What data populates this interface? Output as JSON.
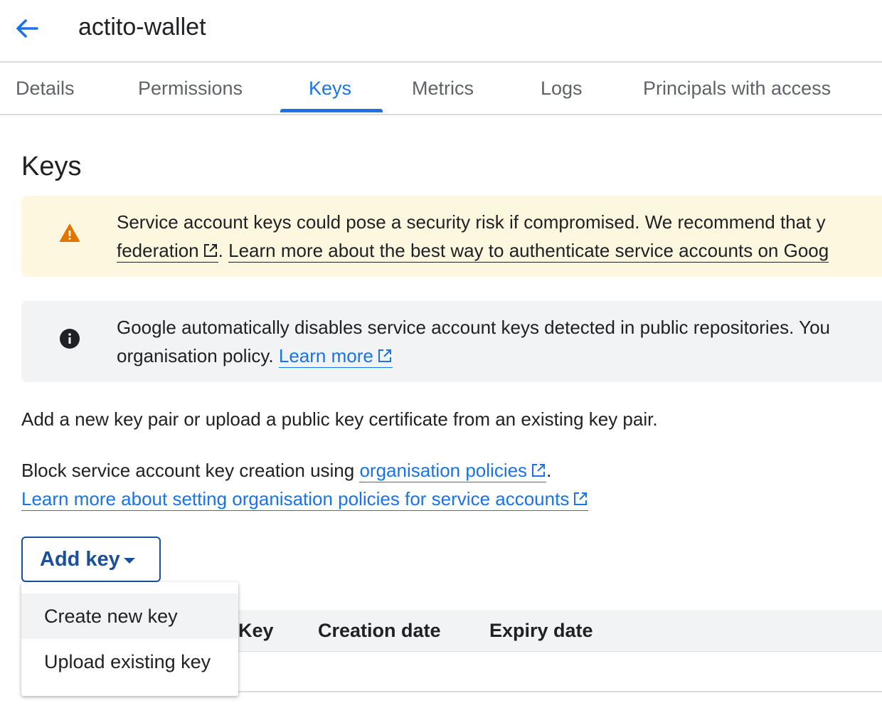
{
  "header": {
    "title": "actito-wallet"
  },
  "tabs": [
    {
      "label": "Details"
    },
    {
      "label": "Permissions"
    },
    {
      "label": "Keys"
    },
    {
      "label": "Metrics"
    },
    {
      "label": "Logs"
    },
    {
      "label": "Principals with access"
    }
  ],
  "active_tab": "Keys",
  "page": {
    "heading": "Keys"
  },
  "warning_banner": {
    "line1": "Service account keys could pose a security risk if compromised. We recommend that y",
    "link1": "federation",
    "period": ".",
    "link2": "Learn more about the best way to authenticate service accounts on Goog"
  },
  "info_banner": {
    "line1": "Google automatically disables service account keys detected in public repositories. You",
    "line2": "organisation policy.",
    "link": "Learn more"
  },
  "description": "Add a new key pair or upload a public key certificate from an existing key pair.",
  "block": {
    "text": "Block service account key creation using",
    "link": "organisation policies",
    "period": ".",
    "learn_link": "Learn more about setting organisation policies for service accounts"
  },
  "add_key_button": {
    "label": "Add key"
  },
  "dropdown": {
    "items": [
      {
        "label": "Create new key"
      },
      {
        "label": "Upload existing key"
      }
    ]
  },
  "table": {
    "columns": [
      "Key",
      "Creation date",
      "Expiry date"
    ]
  },
  "colors": {
    "accent": "#1a73e8",
    "button_text": "#1a4f9c",
    "warning_bg": "#fef7e0",
    "warning_icon": "#e37400",
    "info_bg": "#f1f3f4"
  }
}
